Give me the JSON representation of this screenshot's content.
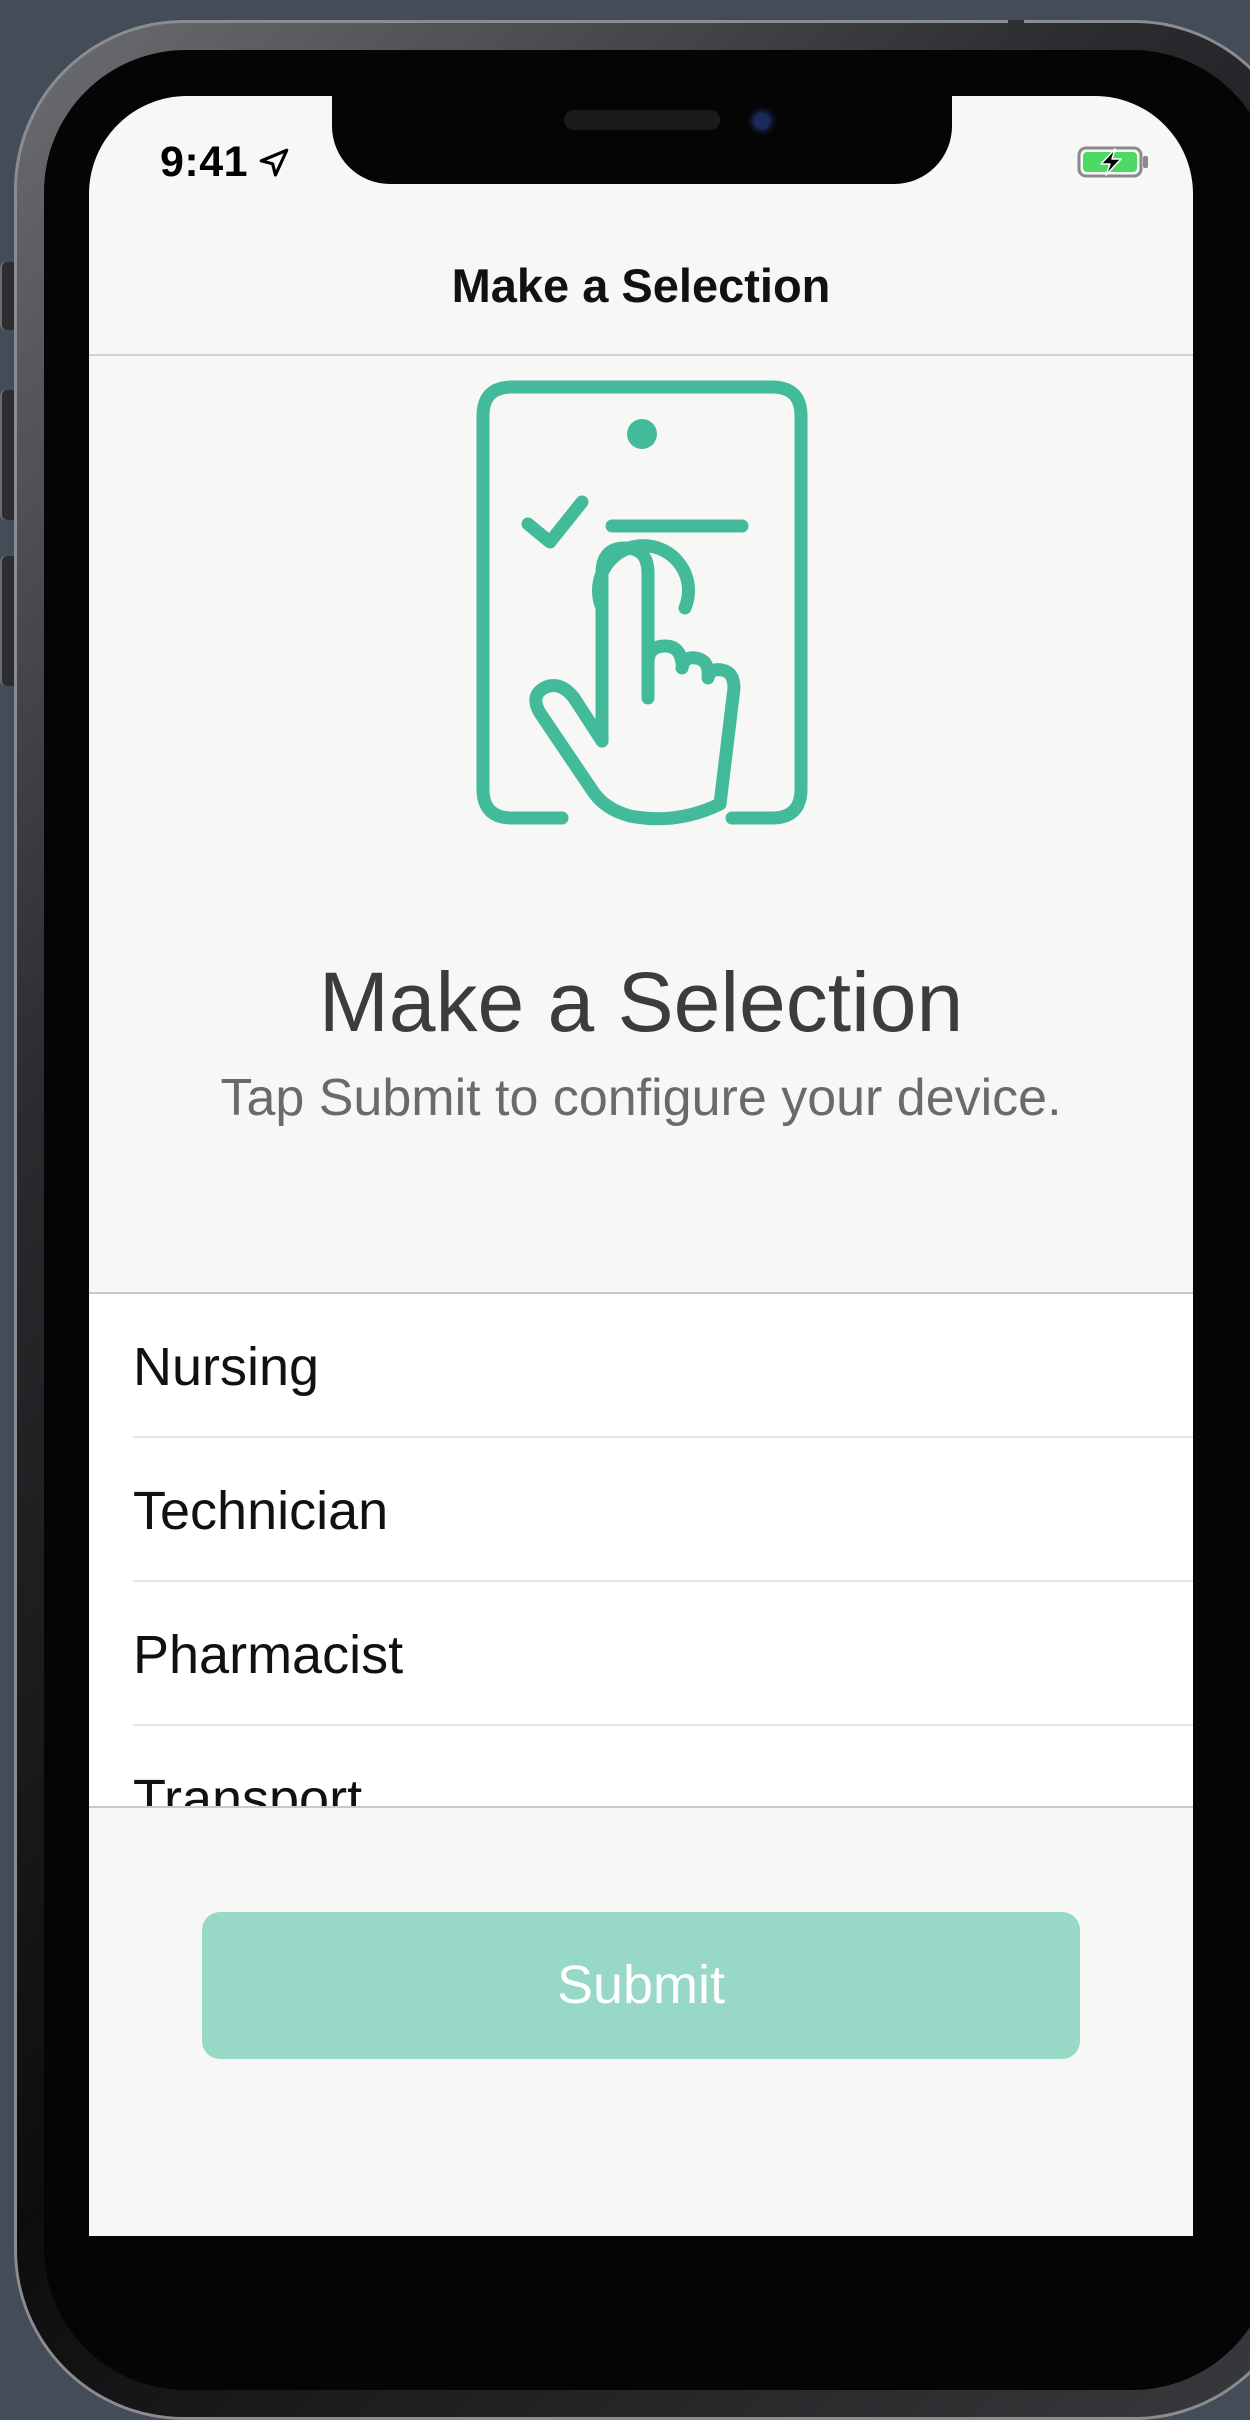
{
  "status_bar": {
    "time": "9:41",
    "icons": [
      "location-arrow-icon",
      "battery-charging-icon"
    ]
  },
  "nav": {
    "title": "Make a Selection"
  },
  "hero": {
    "icon": "tap-checklist-icon",
    "heading": "Make a Selection",
    "subheading": "Tap Submit to configure your device."
  },
  "options": [
    {
      "label": "Nursing"
    },
    {
      "label": "Technician"
    },
    {
      "label": "Pharmacist"
    },
    {
      "label": "Transport"
    }
  ],
  "submit": {
    "label": "Submit"
  },
  "colors": {
    "accent": "#43bb9a",
    "button_disabled": "#98d8c7",
    "background": "#f7f7f5"
  }
}
